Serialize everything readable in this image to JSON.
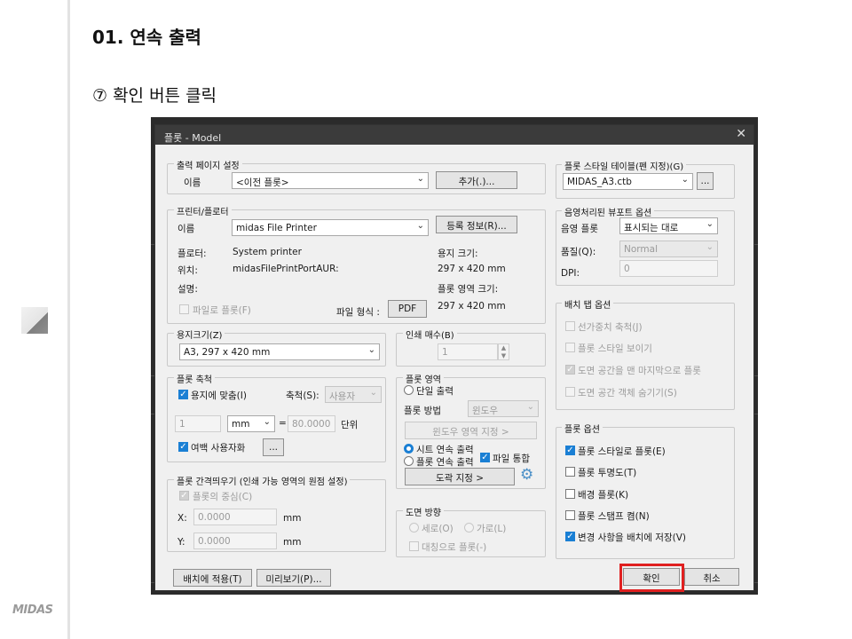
{
  "page": {
    "heading": "01. 연속 출력",
    "step": "⑦ 확인 버튼 클릭",
    "logo": "MIDAS"
  },
  "dialog": {
    "title": "플롯 - Model",
    "close_icon": "close-icon",
    "page_setup": {
      "group": "출력 페이지 설정",
      "name_label": "이름",
      "name_value": "<이전 플롯>",
      "add_button": "추가(.)..."
    },
    "printer": {
      "group": "프린터/플로터",
      "name_label": "이름",
      "name_value": "midas File Printer",
      "properties_button": "등록 정보(R)...",
      "plotter_label": "플로터:",
      "plotter_value": "System printer",
      "location_label": "위치:",
      "location_value": "midasFilePrintPortAUR:",
      "description_label": "설명:",
      "plot_to_file": "파일로 플롯(F)",
      "file_format_label": "파일 형식 :",
      "file_format_button": "PDF",
      "paper_size_label": "용지 크기:",
      "paper_size_value": "297 x 420 mm",
      "plot_area_size_label": "플롯 영역 크기:",
      "plot_area_size_value": "297 x 420 mm"
    },
    "paper_size": {
      "group": "용지크기(Z)",
      "value": "A3, 297 x 420 mm"
    },
    "copies": {
      "group": "인쇄 매수(B)",
      "value": "1"
    },
    "scale": {
      "group": "플롯 축척",
      "fit_paper": "용지에 맞춤(I)",
      "scale_label": "축척(S):",
      "scale_value": "사용자",
      "value1": "1",
      "unit": "mm",
      "equals": "=",
      "value2": "80.0000",
      "units_label": "단위",
      "margin_custom": "여백 사용자화",
      "margin_button": "..."
    },
    "plot_area": {
      "group": "플롯 영역",
      "single": "단일 출력",
      "method_label": "플롯 방법",
      "method_value": "윈도우",
      "window_button": "윈도우 영역 지정 >",
      "sheet_continuous": "시트 연속 출력",
      "plot_continuous": "플롯 연속 출력",
      "file_merge": "파일 통합",
      "frame_button": "도곽 지정 >",
      "gear_icon": "gear-icon"
    },
    "offset": {
      "group": "플롯 간격띄우기 (인쇄 가능 영역의 원점 설정)",
      "center": "플롯의 중심(C)",
      "x_label": "X:",
      "x_value": "0.0000",
      "x_unit": "mm",
      "y_label": "Y:",
      "y_value": "0.0000",
      "y_unit": "mm"
    },
    "orientation": {
      "group": "도면 방향",
      "portrait": "세로(O)",
      "landscape": "가로(L)",
      "reverse": "대칭으로 플롯(-)"
    },
    "style_table": {
      "group": "플롯 스타일 테이블(펜 지정)(G)",
      "value": "MIDAS_A3.ctb",
      "edit_button": "..."
    },
    "shaded": {
      "group": "음영처리된 뷰포트 옵션",
      "shade_label": "음영 플롯",
      "shade_value": "표시되는 대로",
      "quality_label": "품질(Q):",
      "quality_value": "Normal",
      "dpi_label": "DPI:",
      "dpi_value": "0"
    },
    "layout_options": {
      "group": "배치 탭 옵션",
      "items": [
        "선가중치 축척(J)",
        "플롯 스타일 보이기",
        "도면 공간을 맨 마지막으로 플롯",
        "도면 공간 객체 숨기기(S)"
      ]
    },
    "plot_options": {
      "group": "플롯 옵션",
      "items": [
        "플롯 스타일로 플롯(E)",
        "플롯 투명도(T)",
        "배경 플롯(K)",
        "플롯 스탬프 켬(N)",
        "변경 사항을 배치에 저장(V)"
      ]
    },
    "footer": {
      "apply_button": "배치에 적용(T)",
      "preview_button": "미리보기(P)...",
      "ok_button": "확인",
      "cancel_button": "취소"
    },
    "colors": {
      "accent": "#1a7fd4",
      "highlight": "#e02020"
    }
  }
}
